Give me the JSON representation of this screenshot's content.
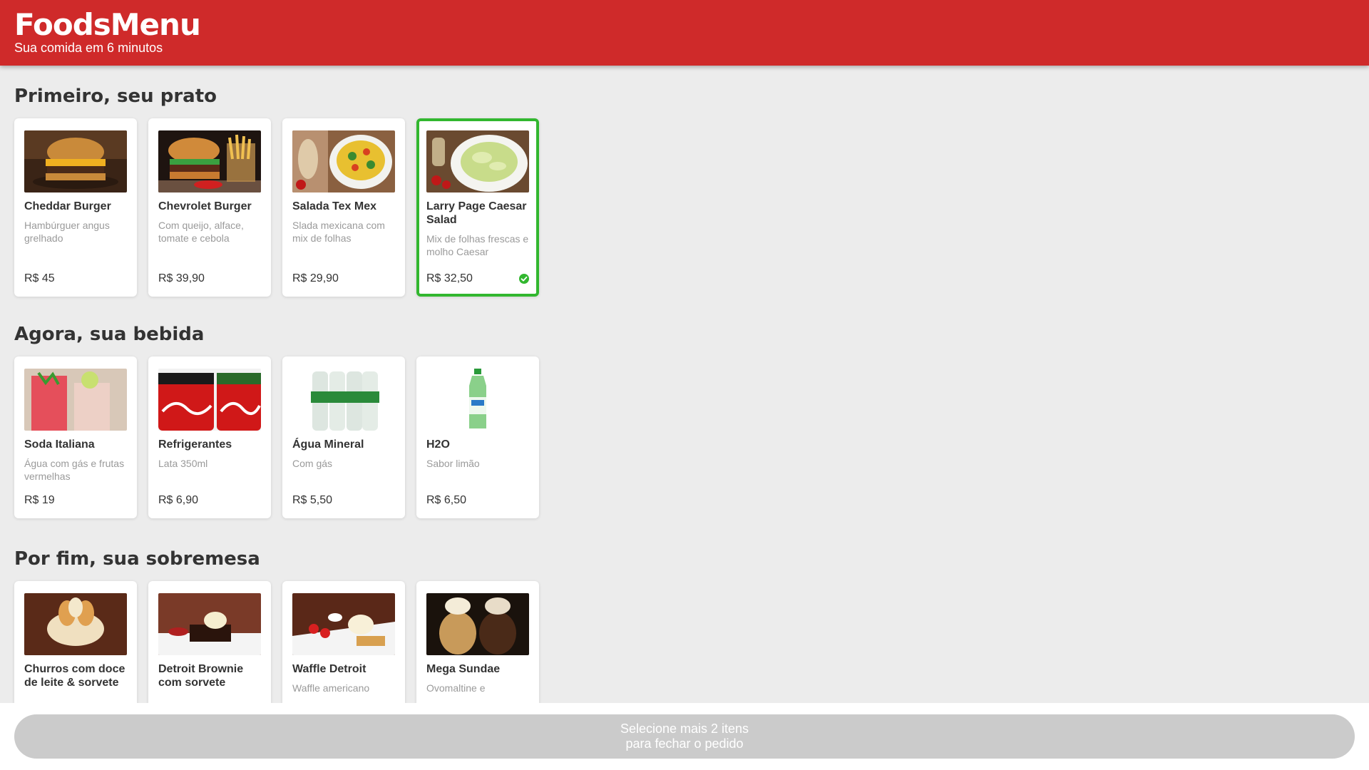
{
  "app": {
    "title": "FoodsMenu",
    "tagline": "Sua comida em 6 minutos",
    "brand_color": "#cf2a2a",
    "selected_color": "#32b72f"
  },
  "sections": [
    {
      "title": "Primeiro, seu prato",
      "items": [
        {
          "name": "Cheddar Burger",
          "description": "Hambúrguer angus grelhado",
          "price": "R$ 45",
          "selected": false
        },
        {
          "name": "Chevrolet Burger",
          "description": "Com queijo, alface, tomate e cebola",
          "price": "R$ 39,90",
          "selected": false
        },
        {
          "name": "Salada Tex Mex",
          "description": "Slada mexicana com mix de folhas",
          "price": "R$ 29,90",
          "selected": false
        },
        {
          "name": "Larry Page Caesar Salad",
          "description": "Mix de folhas frescas e molho Caesar",
          "price": "R$ 32,50",
          "selected": true,
          "icon": "check-circle-icon"
        }
      ]
    },
    {
      "title": "Agora, sua bebida",
      "items": [
        {
          "name": "Soda Italiana",
          "description": "Água com gás e frutas vermelhas",
          "price": "R$ 19",
          "selected": false
        },
        {
          "name": "Refrigerantes",
          "description": "Lata 350ml",
          "price": "R$ 6,90",
          "selected": false
        },
        {
          "name": "Água Mineral",
          "description": "Com gás",
          "price": "R$ 5,50",
          "selected": false
        },
        {
          "name": "H2O",
          "description": "Sabor limão",
          "price": "R$ 6,50",
          "selected": false
        }
      ]
    },
    {
      "title": "Por fim, sua sobremesa",
      "items": [
        {
          "name": "Churros com doce de leite & sorvete",
          "description": "",
          "price": "",
          "selected": false
        },
        {
          "name": "Detroit Brownie com sorvete",
          "description": "",
          "price": "",
          "selected": false
        },
        {
          "name": "Waffle Detroit",
          "description": "Waffle americano",
          "price": "",
          "selected": false
        },
        {
          "name": "Mega Sundae",
          "description": "Ovomaltine e",
          "price": "",
          "selected": false
        }
      ]
    }
  ],
  "footer": {
    "button_line1": "Selecione mais 2 itens",
    "button_line2": "para fechar o pedido"
  }
}
